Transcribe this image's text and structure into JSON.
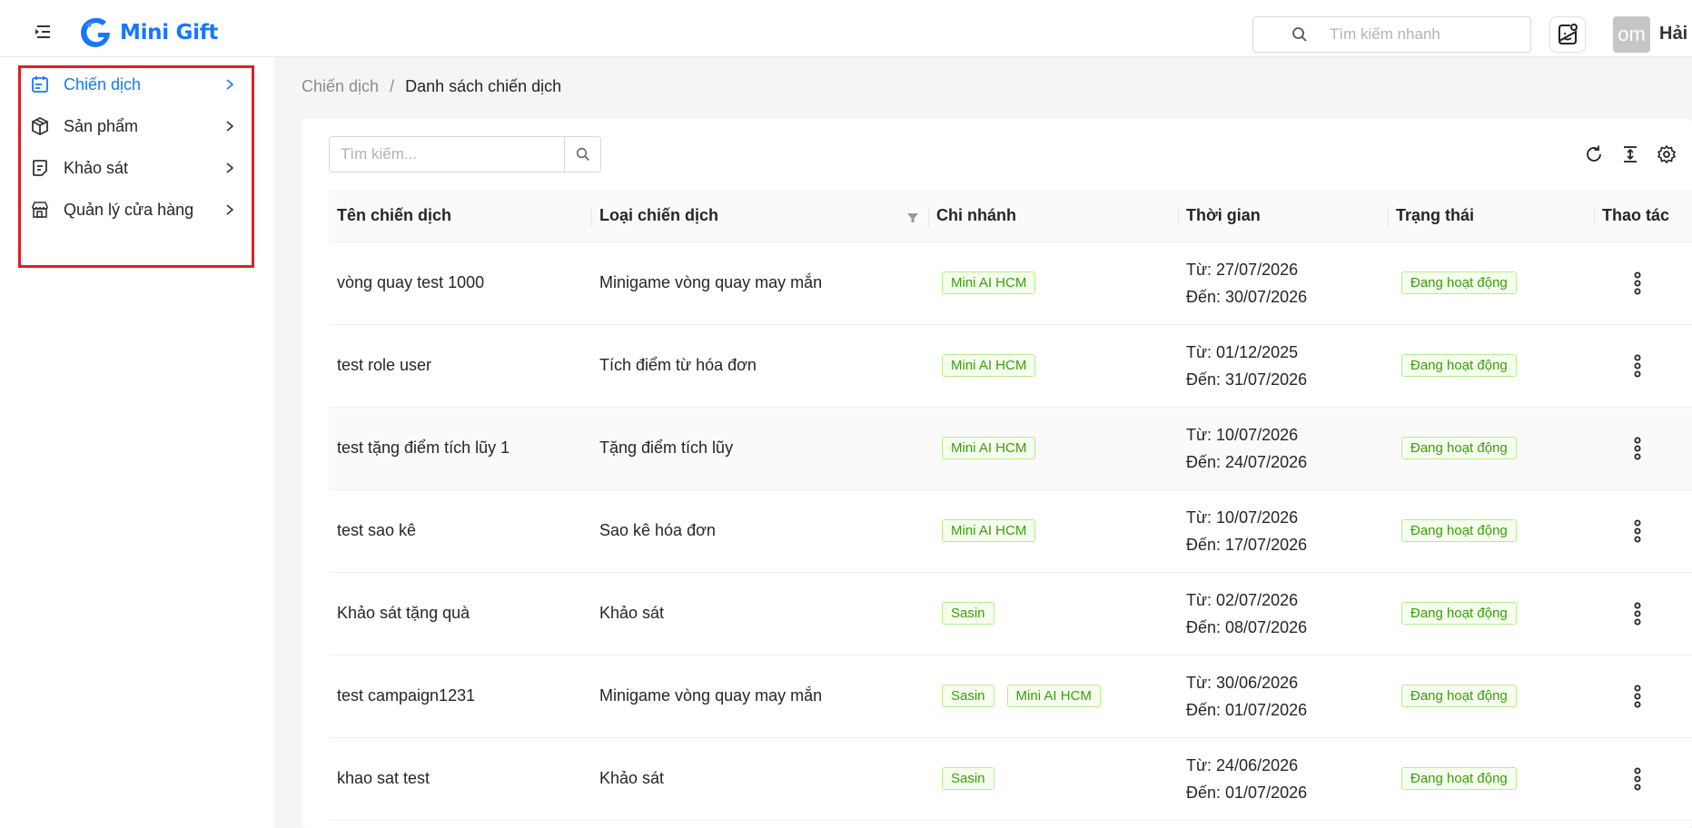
{
  "header": {
    "logo_text": "Mini Gift",
    "search_placeholder": "Tìm kiếm nhanh",
    "avatar_text": "om",
    "username": "Hải"
  },
  "sidebar": {
    "items": [
      {
        "label": "Chiến dịch",
        "icon": "campaign-icon",
        "active": true
      },
      {
        "label": "Sản phẩm",
        "icon": "box-icon",
        "active": false
      },
      {
        "label": "Khảo sát",
        "icon": "survey-icon",
        "active": false
      },
      {
        "label": "Quản lý cửa hàng",
        "icon": "store-icon",
        "active": false
      }
    ]
  },
  "breadcrumb": {
    "parent": "Chiến dịch",
    "separator": "/",
    "current": "Danh sách chiến dịch"
  },
  "table_search": {
    "placeholder": "Tìm kiếm..."
  },
  "table": {
    "columns": [
      "Tên chiến dịch",
      "Loại chiến dịch",
      "Chi nhánh",
      "Thời gian",
      "Trạng thái",
      "Thao tác"
    ],
    "rows": [
      {
        "name": "vòng quay test 1000",
        "type": "Minigame vòng quay may mắn",
        "branches": [
          "Mini AI HCM"
        ],
        "from": "Từ: 27/07/2026",
        "to": "Đến: 30/07/2026",
        "status": "Đang hoạt động"
      },
      {
        "name": "test role user",
        "type": "Tích điểm từ hóa đơn",
        "branches": [
          "Mini AI HCM"
        ],
        "from": "Từ: 01/12/2025",
        "to": "Đến: 31/07/2026",
        "status": "Đang hoạt động"
      },
      {
        "name": "test tặng điểm tích lũy 1",
        "type": "Tặng điểm tích lũy",
        "branches": [
          "Mini AI HCM"
        ],
        "from": "Từ: 10/07/2026",
        "to": "Đến: 24/07/2026",
        "status": "Đang hoạt động"
      },
      {
        "name": "test sao kê",
        "type": "Sao kê hóa đơn",
        "branches": [
          "Mini AI HCM"
        ],
        "from": "Từ: 10/07/2026",
        "to": "Đến: 17/07/2026",
        "status": "Đang hoạt động"
      },
      {
        "name": "Khảo sát tặng quà",
        "type": "Khảo sát",
        "branches": [
          "Sasin"
        ],
        "from": "Từ: 02/07/2026",
        "to": "Đến: 08/07/2026",
        "status": "Đang hoạt động"
      },
      {
        "name": "test campaign1231",
        "type": "Minigame vòng quay may mắn",
        "branches": [
          "Sasin",
          "Mini AI HCM"
        ],
        "from": "Từ: 30/06/2026",
        "to": "Đến: 01/07/2026",
        "status": "Đang hoạt động"
      },
      {
        "name": "khao sat test",
        "type": "Khảo sát",
        "branches": [
          "Sasin"
        ],
        "from": "Từ: 24/06/2026",
        "to": "Đến: 01/07/2026",
        "status": "Đang hoạt động"
      }
    ]
  },
  "colors": {
    "brand": "#1677ff",
    "highlight_border": "#e01e26",
    "tag_border": "#b7eb8f",
    "tag_bg": "#f6ffed",
    "tag_text": "#389e0d"
  }
}
